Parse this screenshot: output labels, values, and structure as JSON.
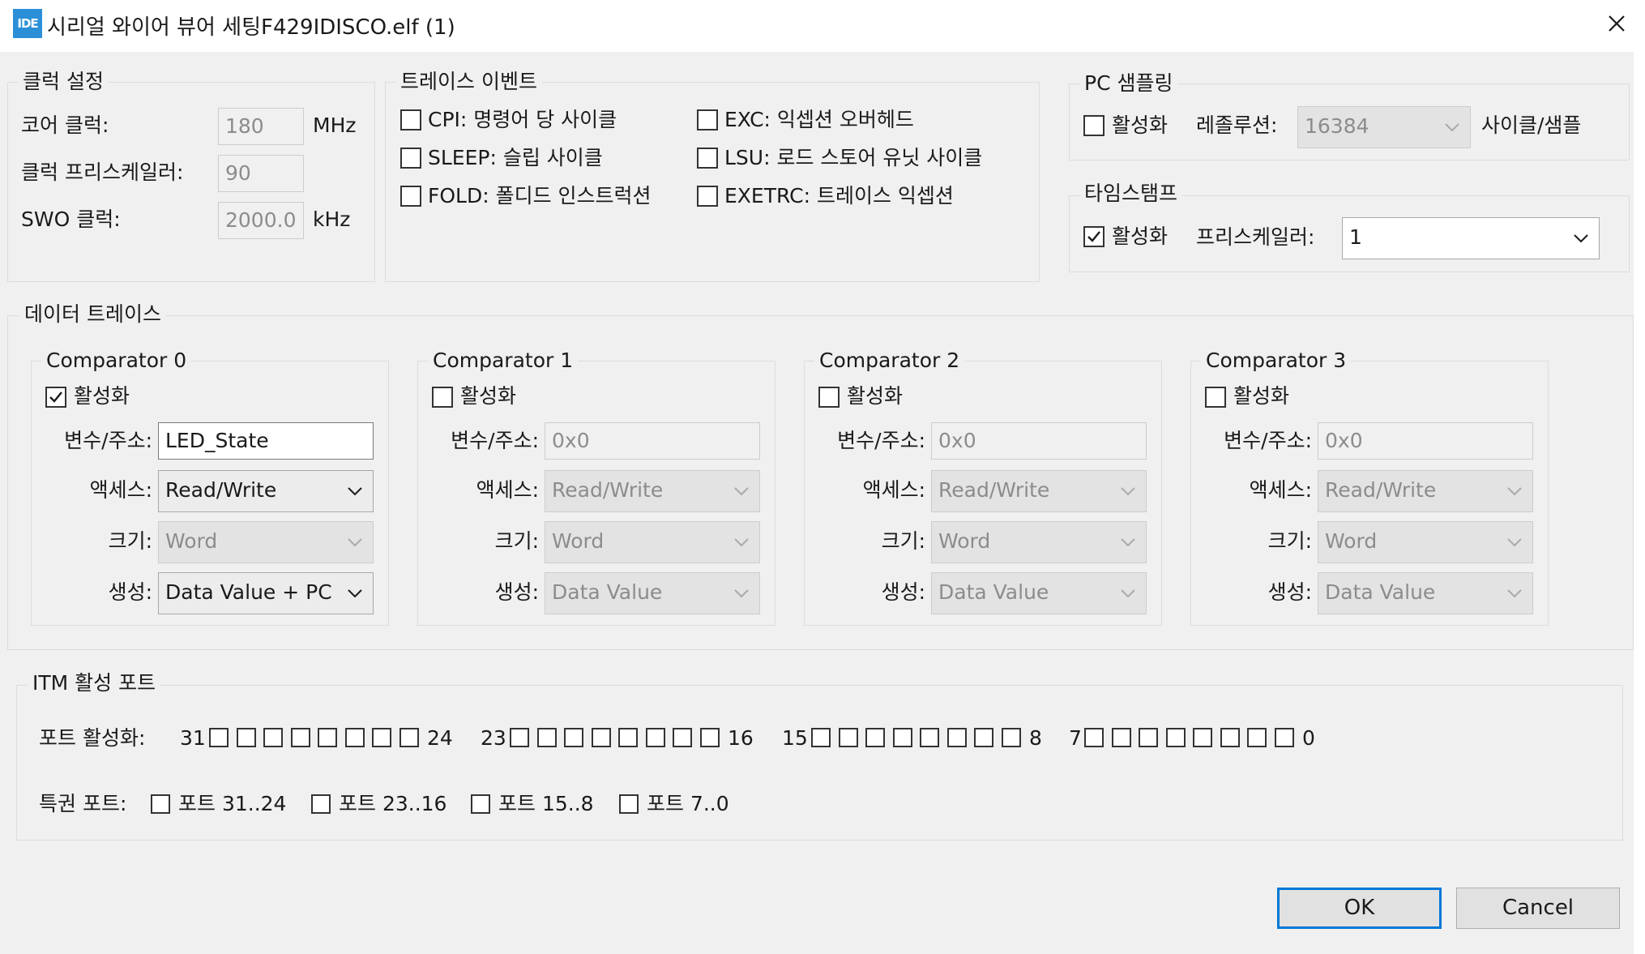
{
  "window": {
    "icon_text": "IDE",
    "title": "시리얼 와이어 뷰어 세팅F429IDISCO.elf (1)"
  },
  "clock": {
    "legend": "클럭 설정",
    "core_label": "코어 클럭:",
    "core_value": "180",
    "core_unit": "MHz",
    "prescaler_label": "클럭 프리스케일러:",
    "prescaler_value": "90",
    "swo_label": "SWO 클럭:",
    "swo_value": "2000.0",
    "swo_unit": "kHz"
  },
  "trace_events": {
    "legend": "트레이스 이벤트",
    "items": [
      {
        "label": "CPI: 명령어 당 사이클",
        "checked": false
      },
      {
        "label": "EXC: 익셉션 오버헤드",
        "checked": false
      },
      {
        "label": "SLEEP: 슬립 사이클",
        "checked": false
      },
      {
        "label": "LSU: 로드 스토어 유닛 사이클",
        "checked": false
      },
      {
        "label": "FOLD: 폴디드 인스트럭션",
        "checked": false
      },
      {
        "label": "EXETRC: 트레이스 익셉션",
        "checked": false
      }
    ]
  },
  "pc_sampling": {
    "legend": "PC 샘플링",
    "enable_label": "활성화",
    "enabled": false,
    "resolution_label": "레졸루션:",
    "resolution_value": "16384",
    "unit_label": "사이클/샘플"
  },
  "timestamp": {
    "legend": "타임스탬프",
    "enable_label": "활성화",
    "enabled": true,
    "prescaler_label": "프리스케일러:",
    "prescaler_value": "1"
  },
  "data_trace": {
    "legend": "데이터 트레이스",
    "comparators": [
      {
        "title": "Comparator 0",
        "enable_label": "활성화",
        "enabled": true,
        "var_label": "변수/주소:",
        "var_value": "LED_State",
        "access_label": "액세스:",
        "access_value": "Read/Write",
        "size_label": "크기:",
        "size_value": "Word",
        "gen_label": "생성:",
        "gen_value": "Data Value + PC"
      },
      {
        "title": "Comparator 1",
        "enable_label": "활성화",
        "enabled": false,
        "var_label": "변수/주소:",
        "var_value": "0x0",
        "access_label": "액세스:",
        "access_value": "Read/Write",
        "size_label": "크기:",
        "size_value": "Word",
        "gen_label": "생성:",
        "gen_value": "Data Value"
      },
      {
        "title": "Comparator 2",
        "enable_label": "활성화",
        "enabled": false,
        "var_label": "변수/주소:",
        "var_value": "0x0",
        "access_label": "액세스:",
        "access_value": "Read/Write",
        "size_label": "크기:",
        "size_value": "Word",
        "gen_label": "생성:",
        "gen_value": "Data Value"
      },
      {
        "title": "Comparator 3",
        "enable_label": "활성화",
        "enabled": false,
        "var_label": "변수/주소:",
        "var_value": "0x0",
        "access_label": "액세스:",
        "access_value": "Read/Write",
        "size_label": "크기:",
        "size_value": "Word",
        "gen_label": "생성:",
        "gen_value": "Data Value"
      }
    ]
  },
  "itm": {
    "legend": "ITM 활성 포트",
    "ports_label": "포트 활성화:",
    "port_groups": [
      {
        "start": "31",
        "end": "24"
      },
      {
        "start": "23",
        "end": "16"
      },
      {
        "start": "15",
        "end": "8"
      },
      {
        "start": "7",
        "end": "0"
      }
    ],
    "privilege_label": "특권 포트:",
    "privilege_items": [
      {
        "label": "포트 31..24",
        "checked": false
      },
      {
        "label": "포트 23..16",
        "checked": false
      },
      {
        "label": "포트 15..8",
        "checked": false
      },
      {
        "label": "포트 7..0",
        "checked": false
      }
    ]
  },
  "buttons": {
    "ok": "OK",
    "cancel": "Cancel"
  },
  "colors": {
    "accent": "#0078d7",
    "icon_bg": "#2b8fd8",
    "dialog_bg": "#f0f0f0"
  }
}
